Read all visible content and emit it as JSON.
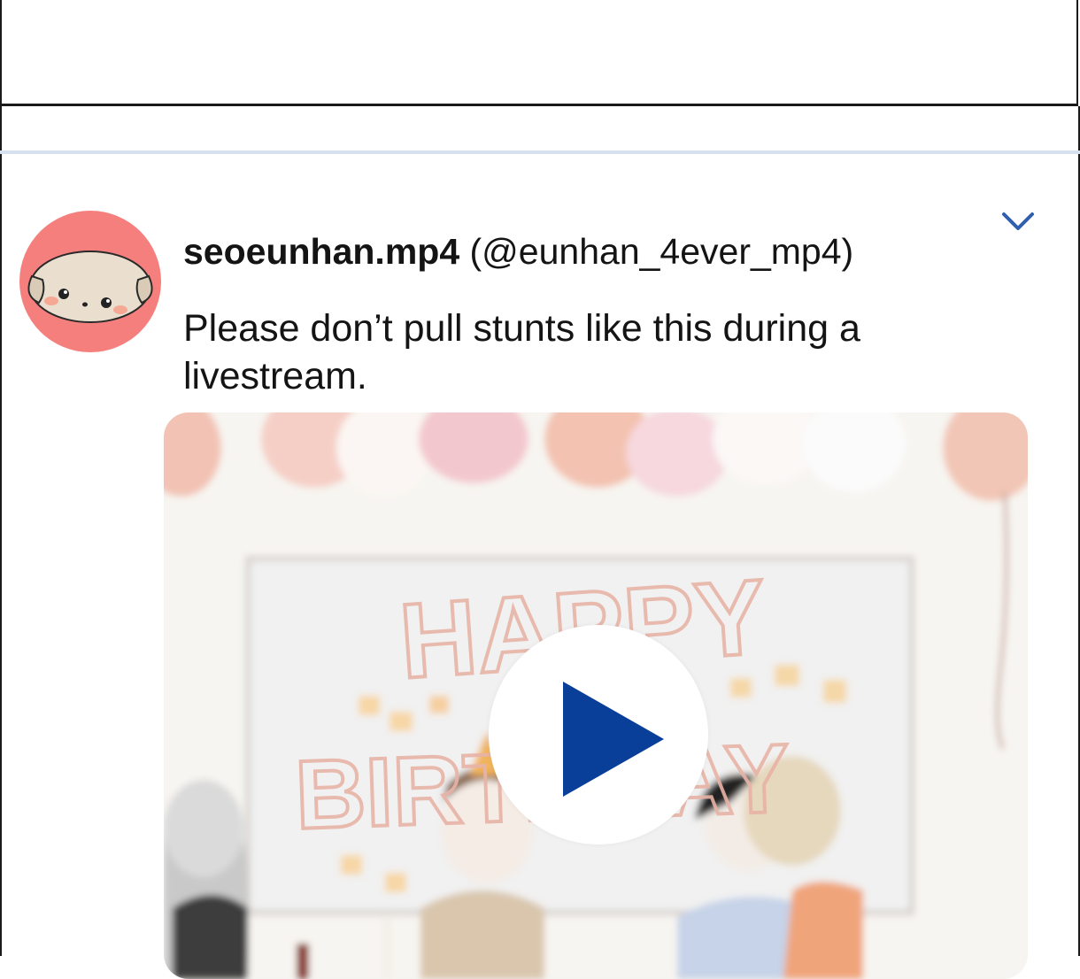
{
  "tweet": {
    "display_name": "seoeunhan.mp4",
    "handle": "(@eunhan_4ever_mp4)",
    "text": "Please don’t pull stunts like this during a livestream."
  },
  "media": {
    "banner_text_line1": "HAPPY",
    "banner_text_line2": "BIRTHDAY",
    "play_icon": "play-icon"
  },
  "icons": {
    "menu": "chevron-down-icon",
    "avatar": "puppy-avatar"
  },
  "colors": {
    "accent": "#0a3f99",
    "avatar_bg": "#f47f7d",
    "separator": "#d6e0ee"
  }
}
